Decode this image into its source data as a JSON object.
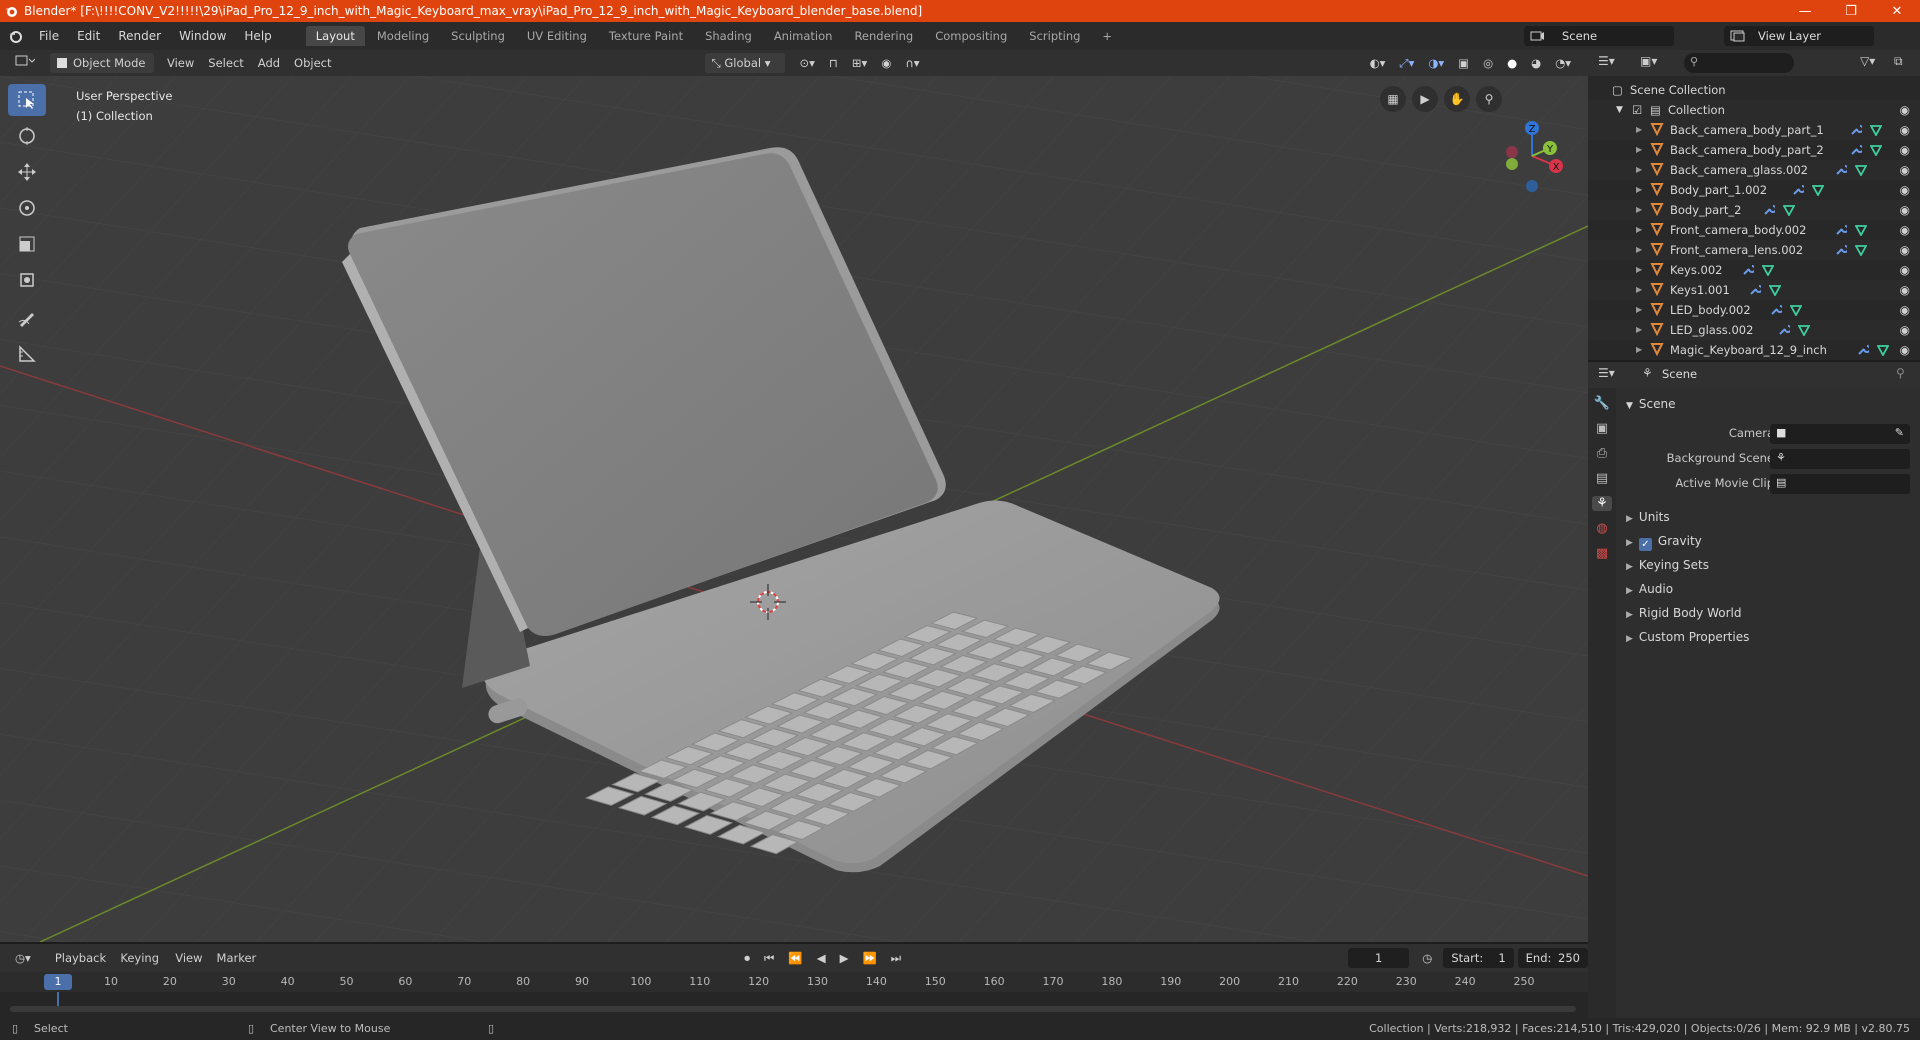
{
  "window": {
    "title": "Blender* [F:\\!!!!CONV_V2!!!!!\\29\\iPad_Pro_12_9_inch_with_Magic_Keyboard_max_vray\\iPad_Pro_12_9_inch_with_Magic_Keyboard_blender_base.blend]",
    "minimize": "—",
    "restore": "❐",
    "close": "✕"
  },
  "menu": [
    "File",
    "Edit",
    "Render",
    "Window",
    "Help"
  ],
  "workspaces": {
    "active": "Layout",
    "tabs": [
      "Layout",
      "Modeling",
      "Sculpting",
      "UV Editing",
      "Texture Paint",
      "Shading",
      "Animation",
      "Rendering",
      "Compositing",
      "Scripting"
    ],
    "add": "+"
  },
  "scene_selector": "Scene",
  "view_layer_selector": "View Layer",
  "viewport_header": {
    "mode": "Object Mode",
    "menus": [
      "View",
      "Select",
      "Add",
      "Object"
    ],
    "transform_orientation": "Global"
  },
  "viewport": {
    "perspective": "User Perspective",
    "collection": "(1) Collection",
    "gizmo_axes": {
      "x": "X",
      "y": "Y",
      "z": "Z"
    }
  },
  "outliner": {
    "search_placeholder": "",
    "root": "Scene Collection",
    "collection": "Collection",
    "items": [
      "Back_camera_body_part_1",
      "Back_camera_body_part_2",
      "Back_camera_glass.002",
      "Body_part_1.002",
      "Body_part_2",
      "Front_camera_body.002",
      "Front_camera_lens.002",
      "Keys.002",
      "Keys1.001",
      "LED_body.002",
      "LED_glass.002",
      "Magic_Keyboard_12_9_inch"
    ]
  },
  "properties": {
    "context": "Scene",
    "panel": "Scene",
    "fields": [
      {
        "label": "Camera"
      },
      {
        "label": "Background Scene"
      },
      {
        "label": "Active Movie Clip"
      }
    ],
    "sections": [
      {
        "label": "Units",
        "checkbox": false
      },
      {
        "label": "Gravity",
        "checkbox": true
      },
      {
        "label": "Keying Sets",
        "checkbox": false
      },
      {
        "label": "Audio",
        "checkbox": false
      },
      {
        "label": "Rigid Body World",
        "checkbox": false
      },
      {
        "label": "Custom Properties",
        "checkbox": false
      }
    ]
  },
  "timeline": {
    "menus": [
      "Playback",
      "Keying",
      "View",
      "Marker"
    ],
    "current_frame": "1",
    "start_label": "Start:",
    "start": "1",
    "end_label": "End:",
    "end": "250",
    "ruler": [
      "1",
      "10",
      "20",
      "30",
      "40",
      "50",
      "60",
      "70",
      "80",
      "90",
      "100",
      "110",
      "120",
      "130",
      "140",
      "150",
      "160",
      "170",
      "180",
      "190",
      "200",
      "210",
      "220",
      "230",
      "240",
      "250"
    ]
  },
  "statusbar": {
    "left_action": "Select",
    "middle_action": "Center View to Mouse",
    "stats": "Collection | Verts:218,932 | Faces:214,510 | Tris:429,020 | Objects:0/26 | Mem: 92.9 MB | v2.80.75"
  },
  "colors": {
    "titlebar": "#e0440e",
    "accent": "#4b6fa8",
    "object_icon": "#e0883c",
    "mesh_icon": "#3dd0a0",
    "modifier_icon": "#6a9ae8"
  }
}
